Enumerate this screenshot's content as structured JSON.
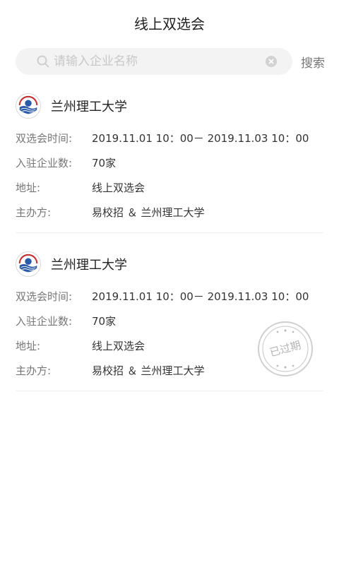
{
  "header": {
    "title": "线上双选会"
  },
  "search": {
    "placeholder": "请输入企业名称",
    "value": "",
    "button_label": "搜索"
  },
  "fairs": [
    {
      "school": "兰州理工大学",
      "time_label": "双选会时间:",
      "time_value": "2019.11.01 10：00－ 2019.11.03 10：00",
      "count_label": "入驻企业数:",
      "count_value": "70家",
      "address_label": "地址:",
      "address_value": "线上双选会",
      "organizer_label": "主办方:",
      "organizer_value": "易校招 ＆ 兰州理工大学"
    },
    {
      "school": "兰州理工大学",
      "time_label": "双选会时间:",
      "time_value": "2019.11.01 10：00－ 2019.11.03 10：00",
      "count_label": "入驻企业数:",
      "count_value": "70家",
      "address_label": "地址:",
      "address_value": "线上双选会",
      "organizer_label": "主办方:",
      "organizer_value": "易校招 ＆ 兰州理工大学",
      "stamp": "已过期"
    }
  ],
  "colors": {
    "stamp": "#cfcfcf",
    "logo_blue": "#2a5aa8",
    "logo_red": "#c83030"
  }
}
